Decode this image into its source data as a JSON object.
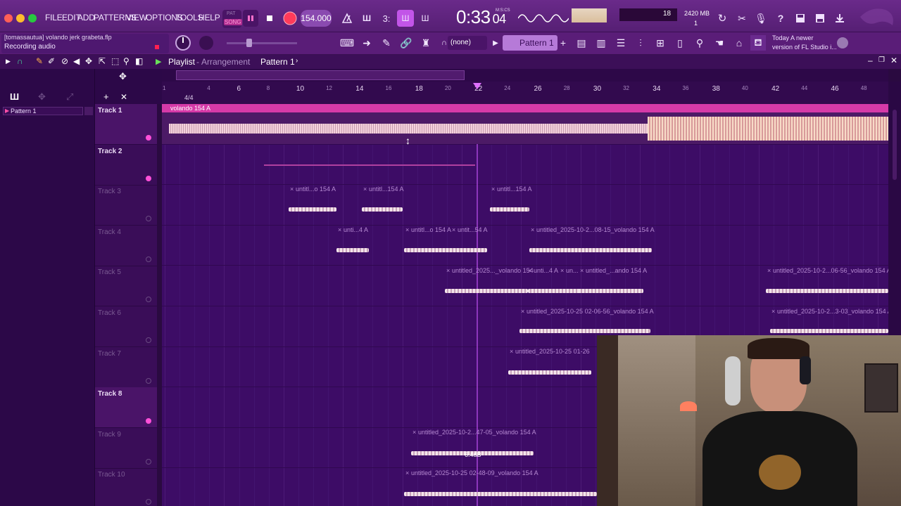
{
  "menu": [
    "FILE",
    "EDIT",
    "ADD",
    "PATTERNS",
    "VIEW",
    "OPTIONS",
    "TOOLS",
    "HELP"
  ],
  "transport": {
    "mode_pat": "PAT",
    "mode_song": "SONG",
    "tempo": "154.000",
    "time": "0:33",
    "time_small": "04",
    "time_unit": "M:S:CS"
  },
  "indicators": {
    "cpu": "18",
    "memory": "2420 MB",
    "poly": "1"
  },
  "news": {
    "line1": "Today  A newer",
    "line2": "version of FL Studio i..."
  },
  "hint": {
    "file": "[tomassautua] volando jerk grabeta.flp",
    "status": "Recording audio"
  },
  "snap": "(none)",
  "pattern_selector": "Pattern 1",
  "playlist": {
    "title": "Playlist",
    "subtitle": "Arrangement",
    "pattern": "Pattern 1",
    "time_sig": "4/4"
  },
  "picker": {
    "item": "Pattern 1"
  },
  "ruler": [
    "1",
    "4",
    "6",
    "8",
    "10",
    "12",
    "14",
    "16",
    "18",
    "20",
    "22",
    "24",
    "26",
    "28",
    "30",
    "32",
    "34",
    "36",
    "38",
    "40",
    "42",
    "44",
    "46",
    "48"
  ],
  "tracks": [
    "Track 1",
    "Track 2",
    "Track 3",
    "Track 4",
    "Track 5",
    "Track 6",
    "Track 7",
    "Track 8",
    "Track 9",
    "Track 10"
  ],
  "clips": {
    "t1": "volando 154 A",
    "t3a": "untitl...o 154 A",
    "t3b": "untitl...154 A",
    "t3c": "untitl...154 A",
    "t4a": "unti...4 A",
    "t4b": "untitl...o 154 A",
    "t4c": "untit...54 A",
    "t4d": "untitled_2025-10-2...08-15_volando 154 A",
    "t5a": "untitled_2025..._volando 154",
    "t5b": "unti...4 A",
    "t5c": "un...",
    "t5d": "untitled_...ando 154 A",
    "t5e": "untitled_2025-10-2...06-56_volando 154 A",
    "t6a": "untitled_2025-10-25 02-06-56_volando 154 A",
    "t6b": "untitled_2025-10-2...3-03_volando 154 A",
    "t7a": "untitled_2025-10-25 01-26",
    "t9a": "untitled_2025-10-2...47-05_volando 154 A",
    "t9gain": "6.4dB",
    "t10a": "untitled_2025-10-25 02-48-09_volando 154 A"
  },
  "colors": {
    "accent": "#d63aa8",
    "bg": "#3d0c66",
    "wave": "#f3d2dc"
  }
}
